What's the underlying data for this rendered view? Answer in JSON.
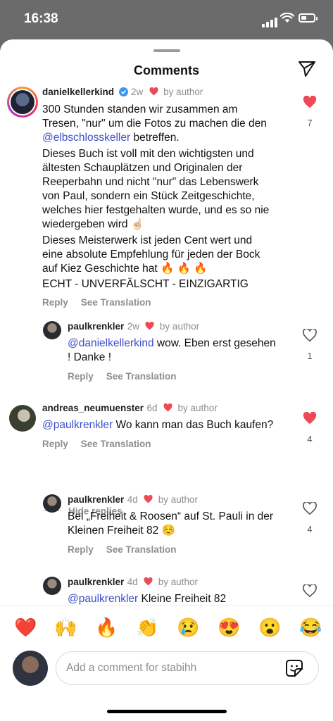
{
  "status": {
    "time": "16:38"
  },
  "header": {
    "title": "Comments",
    "send_icon": "paper-plane-icon"
  },
  "comments": [
    {
      "username": "danielkellerkind",
      "verified": true,
      "age": "2w",
      "author_like": "by author",
      "text_lines": [
        "300 Stunden standen wir zusammen am",
        "Tresen, \"nur\" um die Fotos zu machen die den",
        "betreffen.",
        "Dieses Buch ist voll mit den wichtigsten und",
        "ältesten Schauplätzen und Originalen der",
        "Reeperbahn und nicht \"nur\" das Lebenswerk",
        "von Paul, sondern ein Stück Zeitgeschichte,",
        "welches hier festgehalten wurde, und es so nie",
        "wiedergeben wird ☝🏻",
        "Dieses Meisterwerk ist jeden Cent wert und",
        "eine absolute Empfehlung für jeden der Bock",
        "auf Kiez Geschichte hat 🔥 🔥 🔥",
        "ECHT - UNVERFÄLSCHT - EINZIGARTIG"
      ],
      "mention": "@elbschlosskeller",
      "reply": "Reply",
      "see_translation": "See Translation",
      "like_count": "7",
      "liked": true
    },
    {
      "username": "paulkrenkler",
      "age": "2w",
      "author_like": "by author",
      "mention": "@danielkellerkind",
      "text_lines": [
        "wow. Eben erst gesehen",
        "! Danke !"
      ],
      "reply": "Reply",
      "see_translation": "See Translation",
      "like_count": "1",
      "liked": false
    },
    {
      "username": "andreas_neumuenster",
      "age": "6d",
      "author_like": "by author",
      "mention": "@paulkrenkler",
      "text_lines": [
        "Wo kann man das Buch kaufen?"
      ],
      "reply": "Reply",
      "see_translation": "See Translation",
      "like_count": "4",
      "liked": true
    },
    {
      "username": "paulkrenkler",
      "age": "4d",
      "author_like": "by author",
      "text_lines": [
        "Bei „Freiheit & Roosen“ auf St. Pauli in der",
        "Kleinen Freiheit 82 ☺️"
      ],
      "reply": "Reply",
      "see_translation": "See Translation",
      "like_count": "4",
      "liked": false
    },
    {
      "username": "paulkrenkler",
      "age": "4d",
      "author_like": "by author",
      "mention": "@paulkrenkler",
      "text_lines": [
        "Kleine Freiheit 82"
      ],
      "liked": false
    }
  ],
  "hide_replies": "Hide replies",
  "emoji_bar": [
    "❤️",
    "🙌",
    "🔥",
    "👏",
    "😢",
    "😍",
    "😮",
    "😂"
  ],
  "composer": {
    "placeholder": "Add a comment for stabihh",
    "sticker_icon": "sticker-icon"
  },
  "colors": {
    "heart_red": "#ed4956",
    "mention_blue": "#3b4ecb",
    "verified_blue": "#3897f0"
  }
}
